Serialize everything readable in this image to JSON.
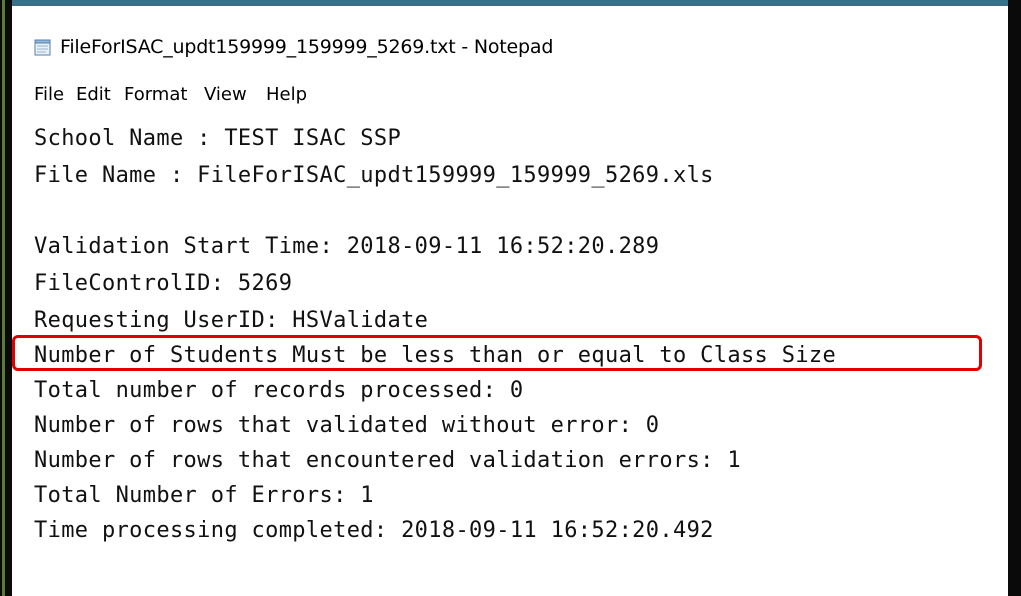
{
  "window": {
    "title": "FileForISAC_updt159999_159999_5269.txt - Notepad",
    "app_icon": "notepad-icon"
  },
  "menu": {
    "items": [
      "File",
      "Edit",
      "Format",
      "View",
      "Help"
    ]
  },
  "document": {
    "lines": [
      "School Name : TEST ISAC SSP",
      "File Name : FileForISAC_updt159999_159999_5269.xls",
      "",
      "Validation Start Time: 2018-09-11 16:52:20.289",
      "FileControlID: 5269",
      "Requesting UserID: HSValidate",
      "Number of Students Must be less than or equal to Class Size",
      "Total number of records processed: 0",
      "Number of rows that validated without error: 0",
      "Number of rows that encountered validation errors: 1",
      "Total Number of Errors: 1",
      "Time processing completed: 2018-09-11 16:52:20.492"
    ],
    "highlighted_line_index": 6
  },
  "colors": {
    "highlight_border": "#e10000",
    "background": "#ffffff"
  }
}
